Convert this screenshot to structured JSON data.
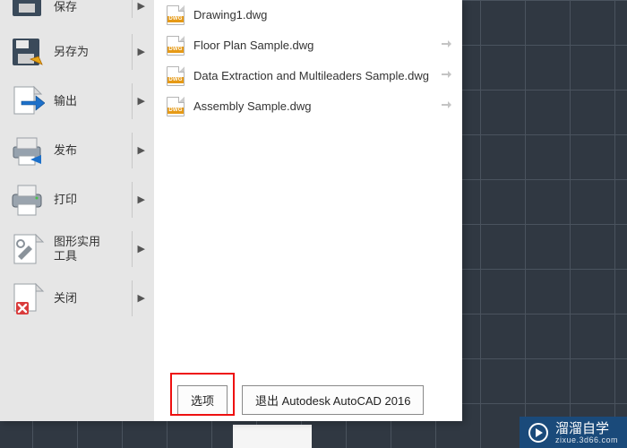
{
  "sidebar": {
    "items": [
      {
        "label": "保存"
      },
      {
        "label": "另存为"
      },
      {
        "label": "输出"
      },
      {
        "label": "发布"
      },
      {
        "label": "打印"
      },
      {
        "label": "图形实用\n工具"
      },
      {
        "label": "关闭"
      }
    ]
  },
  "recent_files": [
    {
      "name": "Drawing1.dwg",
      "pinned": false,
      "show_pin": false
    },
    {
      "name": "Floor Plan Sample.dwg",
      "pinned": false,
      "show_pin": true
    },
    {
      "name": "Data Extraction and Multileaders Sample.dwg",
      "pinned": false,
      "show_pin": true
    },
    {
      "name": "Assembly Sample.dwg",
      "pinned": false,
      "show_pin": true
    }
  ],
  "buttons": {
    "options": "选项",
    "exit": "退出 Autodesk AutoCAD 2016"
  },
  "watermark": {
    "title": "溜溜自学",
    "url": "zixue.3d66.com"
  }
}
